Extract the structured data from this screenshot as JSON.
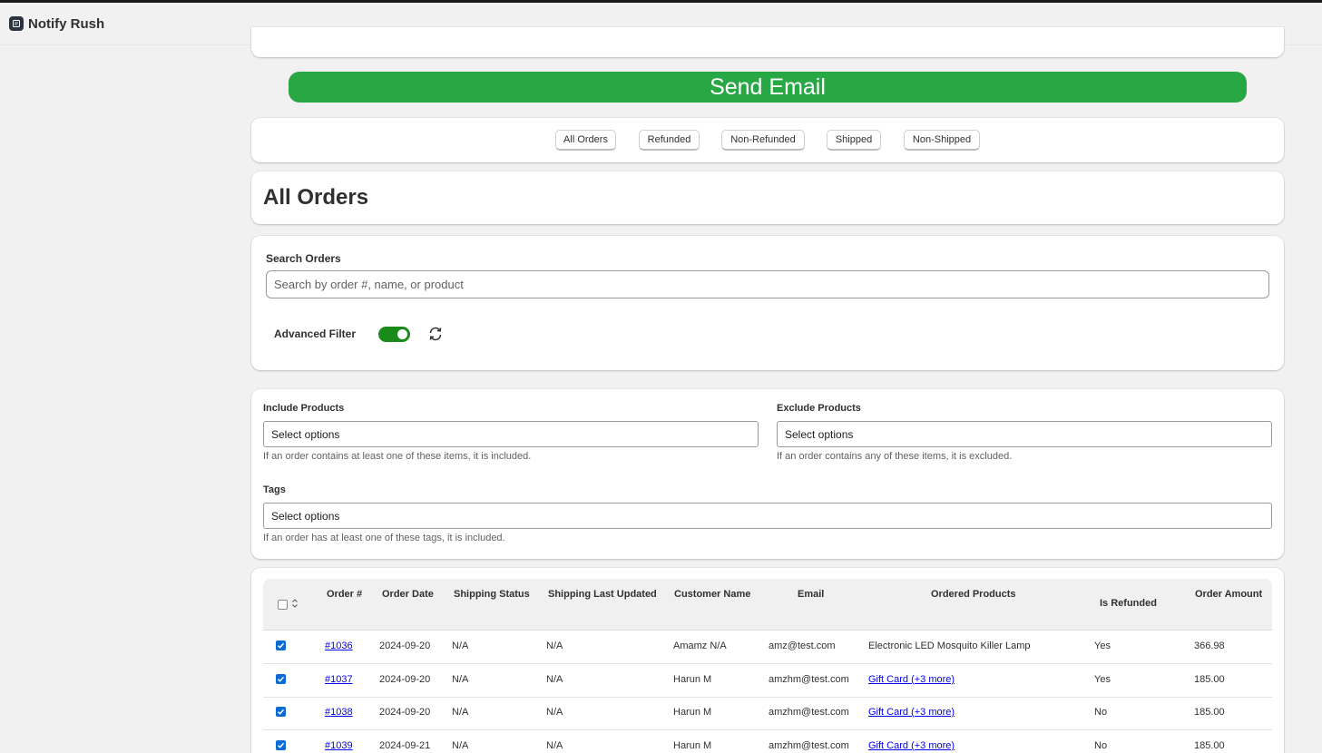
{
  "app": {
    "title": "Notify Rush",
    "icon": "notify-rush-app-icon"
  },
  "send_email": {
    "label": "Send Email",
    "color": "#28a745"
  },
  "filter_tabs": [
    {
      "label": "All Orders"
    },
    {
      "label": "Refunded"
    },
    {
      "label": "Non-Refunded"
    },
    {
      "label": "Shipped"
    },
    {
      "label": "Non-Shipped"
    }
  ],
  "page_title": "All Orders",
  "search": {
    "label": "Search Orders",
    "placeholder": "Search by order #, name, or product",
    "value": ""
  },
  "advanced_filter": {
    "label": "Advanced Filter",
    "enabled": true,
    "toggle_color": "#1a8a1a",
    "refresh_icon": "refresh-icon"
  },
  "include_products": {
    "label": "Include Products",
    "value": "Select options",
    "help": "If an order contains at least one of these items, it is included."
  },
  "exclude_products": {
    "label": "Exclude Products",
    "value": "Select options",
    "help": "If an order contains any of these items, it is excluded."
  },
  "tags": {
    "label": "Tags",
    "value": "Select options",
    "help": "If an order has at least one of these tags, it is included."
  },
  "table": {
    "columns": [
      "Order #",
      "Order Date",
      "Shipping Status",
      "Shipping Last Updated",
      "Customer Name",
      "Email",
      "Ordered Products",
      "Is Refunded",
      "Order Amount"
    ],
    "rows": [
      {
        "checked": true,
        "order": "#1036",
        "date": "2024-09-20",
        "shipping_status": "N/A",
        "shipping_updated": "N/A",
        "customer": "Amamz N/A",
        "email": "amz@test.com",
        "products": "Electronic LED Mosquito Killer Lamp",
        "products_link": false,
        "refunded": "Yes",
        "amount": "366.98"
      },
      {
        "checked": true,
        "order": "#1037",
        "date": "2024-09-20",
        "shipping_status": "N/A",
        "shipping_updated": "N/A",
        "customer": "Harun M",
        "email": "amzhm@test.com",
        "products": "Gift Card (+3 more)",
        "products_link": true,
        "refunded": "Yes",
        "amount": "185.00"
      },
      {
        "checked": true,
        "order": "#1038",
        "date": "2024-09-20",
        "shipping_status": "N/A",
        "shipping_updated": "N/A",
        "customer": "Harun M",
        "email": "amzhm@test.com",
        "products": "Gift Card (+3 more)",
        "products_link": true,
        "refunded": "No",
        "amount": "185.00"
      },
      {
        "checked": true,
        "order": "#1039",
        "date": "2024-09-21",
        "shipping_status": "N/A",
        "shipping_updated": "N/A",
        "customer": "Harun M",
        "email": "amzhm@test.com",
        "products": "Gift Card (+3 more)",
        "products_link": true,
        "refunded": "No",
        "amount": "185.00"
      }
    ]
  }
}
